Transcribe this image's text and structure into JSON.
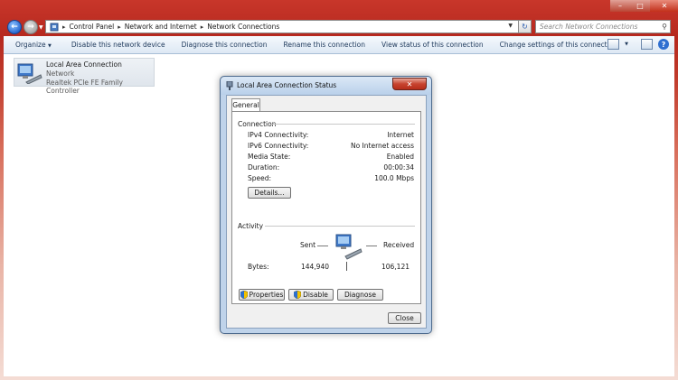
{
  "explorer": {
    "breadcrumbs": [
      "Control Panel",
      "Network and Internet",
      "Network Connections"
    ],
    "search_placeholder": "Search Network Connections"
  },
  "toolbar": {
    "organize": "Organize",
    "items": [
      "Disable this network device",
      "Diagnose this connection",
      "Rename this connection",
      "View status of this connection",
      "Change settings of this connection"
    ]
  },
  "connection": {
    "name": "Local Area Connection",
    "network": "Network",
    "adapter": "Realtek PCIe FE Family Controller"
  },
  "dialog": {
    "title": "Local Area Connection Status",
    "tab": "General",
    "connection_group": "Connection",
    "rows": [
      {
        "label": "IPv4 Connectivity:",
        "value": "Internet"
      },
      {
        "label": "IPv6 Connectivity:",
        "value": "No Internet access"
      },
      {
        "label": "Media State:",
        "value": "Enabled"
      },
      {
        "label": "Duration:",
        "value": "00:00:34"
      },
      {
        "label": "Speed:",
        "value": "100.0 Mbps"
      }
    ],
    "details_button": "Details...",
    "activity_group": "Activity",
    "sent_label": "Sent",
    "received_label": "Received",
    "bytes_label": "Bytes:",
    "bytes_sent": "144,940",
    "bytes_received": "106,121",
    "properties_button": "Properties",
    "disable_button": "Disable",
    "diagnose_button": "Diagnose",
    "close_button": "Close"
  }
}
